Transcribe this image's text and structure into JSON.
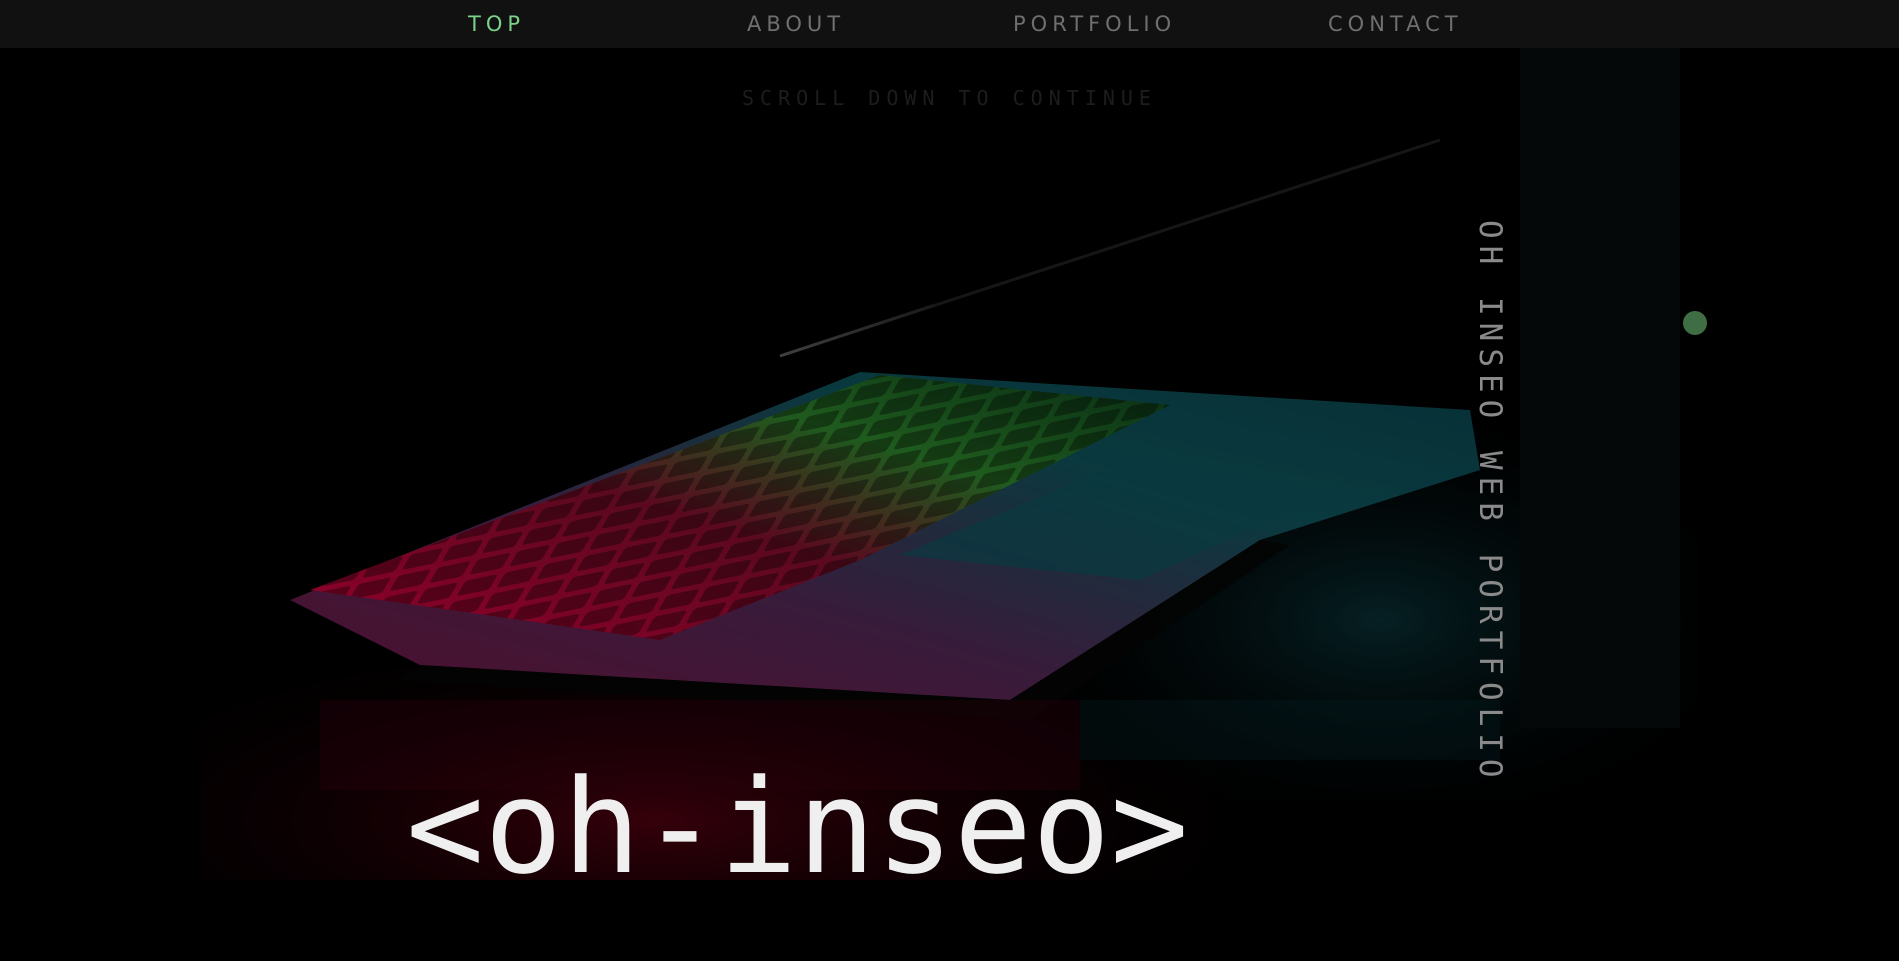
{
  "nav": {
    "items": [
      {
        "label": "TOP",
        "active": true
      },
      {
        "label": "ABOUT",
        "active": false
      },
      {
        "label": "PORTFOLIO",
        "active": false
      },
      {
        "label": "CONTACT",
        "active": false
      }
    ]
  },
  "hero": {
    "scroll_hint": "SCROLL DOWN TO CONTINUE",
    "vertical_title": "OH INSEO WEB PORTFOLIO",
    "logo": "<oh-inseo>",
    "background_image": "laptop-keyboard-rgb-glow"
  },
  "colors": {
    "accent": "#7bd38a",
    "nav_background": "#111111",
    "nav_text": "#6f6f6f",
    "dot": "#3f6e45",
    "logo_text": "#efefef"
  }
}
